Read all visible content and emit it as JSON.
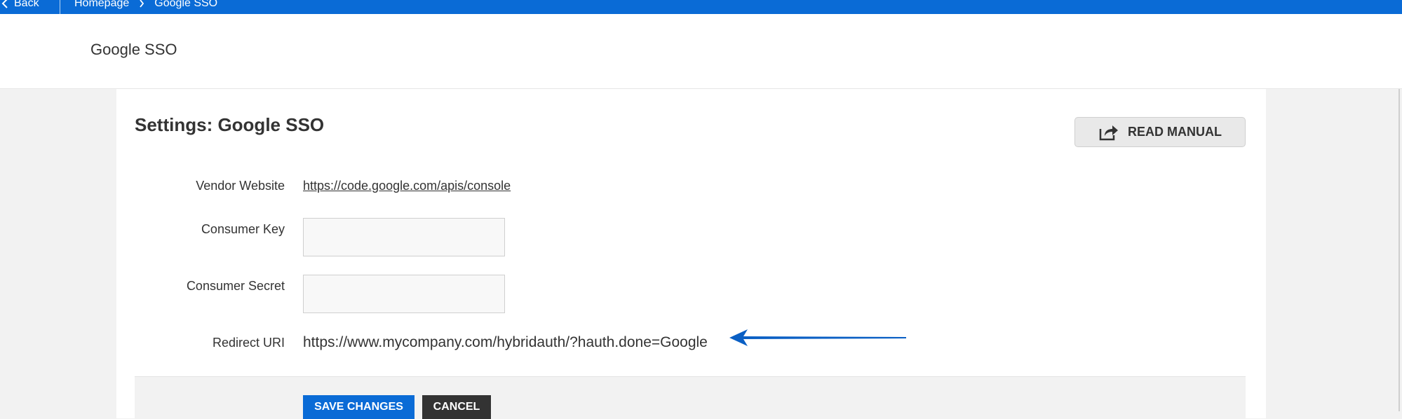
{
  "topbar": {
    "back_label": "Back",
    "breadcrumbs": [
      "Homepage",
      "Google SSO"
    ]
  },
  "header": {
    "title": "Google SSO"
  },
  "panel": {
    "title": "Settings: Google SSO",
    "manual_button": "READ MANUAL"
  },
  "form": {
    "vendor_label": "Vendor Website",
    "vendor_url": "https://code.google.com/apis/console",
    "consumer_key_label": "Consumer Key",
    "consumer_key_value": "",
    "consumer_secret_label": "Consumer Secret",
    "consumer_secret_value": "",
    "redirect_label": "Redirect URI",
    "redirect_value": "https://www.mycompany.com/hybridauth/?hauth.done=Google"
  },
  "footer": {
    "save_label": "SAVE CHANGES",
    "cancel_label": "CANCEL"
  },
  "colors": {
    "accent": "#0a6bd6",
    "cancel": "#333333",
    "annotation_arrow": "#0a5fc4"
  }
}
